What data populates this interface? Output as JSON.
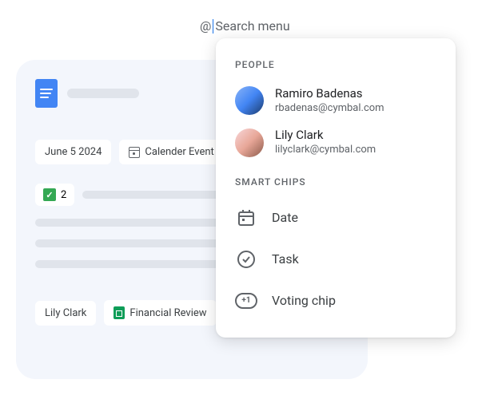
{
  "search": {
    "at": "@",
    "placeholder": "Search menu"
  },
  "document": {
    "chips": {
      "date": "June 5 2024",
      "calendar": "Calender Event",
      "vote_count": "2",
      "person": "Lily Clark",
      "file": "Financial Review"
    }
  },
  "menu": {
    "sections": {
      "people": "PEOPLE",
      "smart_chips": "SMART CHIPS"
    },
    "people": [
      {
        "name": "Ramiro Badenas",
        "email": "rbadenas@cymbal.com"
      },
      {
        "name": "Lily Clark",
        "email": "lilyclark@cymbal.com"
      }
    ],
    "chips": {
      "date": "Date",
      "task": "Task",
      "voting": "Voting chip",
      "voting_badge": "+1"
    }
  }
}
